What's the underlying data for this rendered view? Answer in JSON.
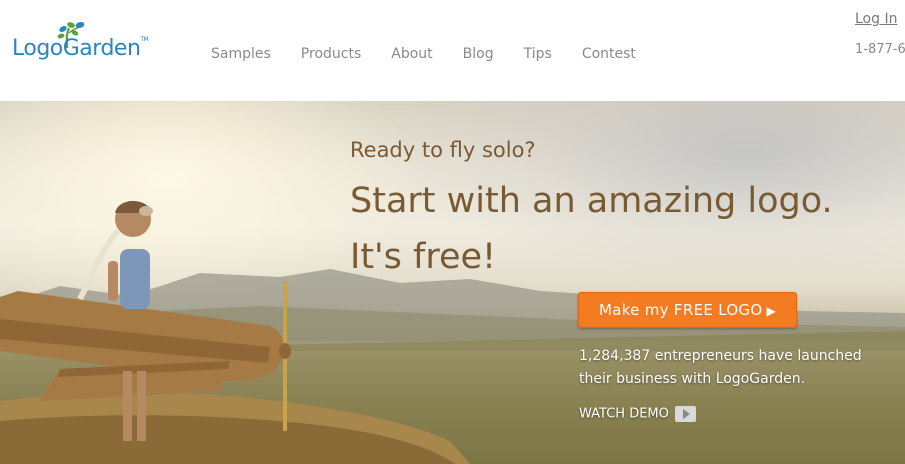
{
  "header": {
    "logo": {
      "text": "LogoGarden",
      "trademark": "TM",
      "icon": "tree-icon",
      "color": "#2a86c2"
    },
    "nav": [
      {
        "label": "Samples"
      },
      {
        "label": "Products"
      },
      {
        "label": "About"
      },
      {
        "label": "Blog"
      },
      {
        "label": "Tips"
      },
      {
        "label": "Contest"
      }
    ],
    "login_label": "Log In",
    "phone": "1-877-6"
  },
  "hero": {
    "tagline": "Ready to fly solo?",
    "headline_line1": "Start with an amazing logo.",
    "headline_line2": "It's free!",
    "cta_label": "Make my FREE LOGO",
    "cta_arrow": "▶",
    "cta_color": "#f37b22",
    "stats_line1": "1,284,387 entrepreneurs have launched",
    "stats_line2": "their business with LogoGarden.",
    "watch_demo_label": "WATCH DEMO",
    "heading_color": "#7a5a32"
  }
}
